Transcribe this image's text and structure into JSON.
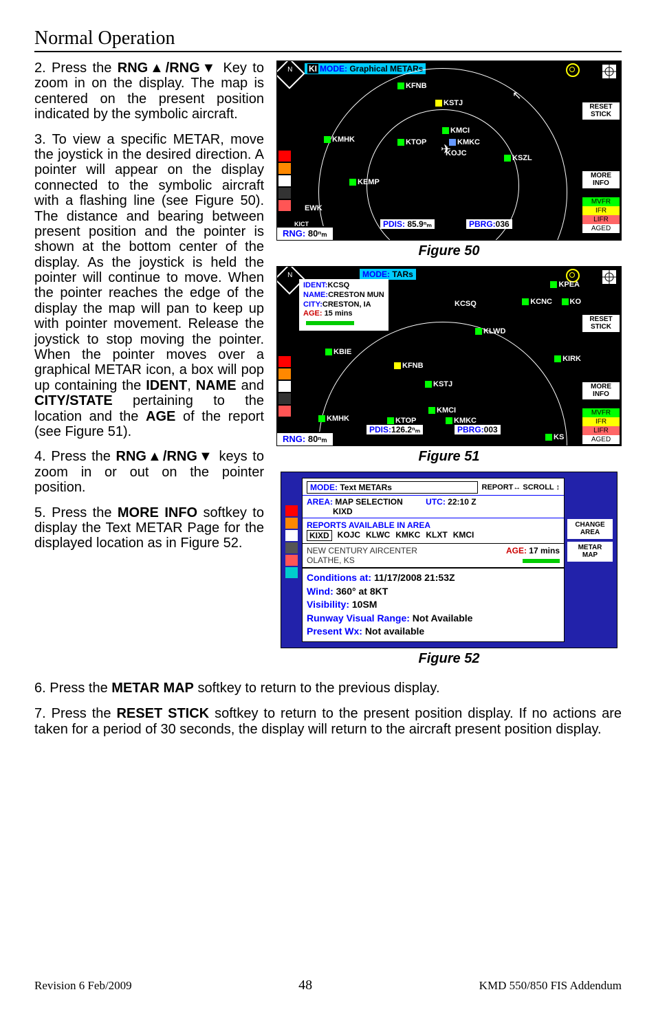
{
  "header": {
    "title": "Normal Operation"
  },
  "step2_a": "2. Press the ",
  "step2_key": "RNG▲/RNG▼",
  "step2_b": " Key to zoom in on the display. The map is centered on the present position indicated by the symbolic aircraft.",
  "step3": "3. To view a specific METAR, move the joystick in the desired direction. A pointer will appear on the display connected to the symbolic aircraft with a flashing line (see Figure 50). The distance and bearing between present position and the pointer is shown at the bottom center of the display. As the joystick is held the pointer will continue to move. When the pointer reaches the edge of the display the map will pan to keep up with pointer movement. Release the joystick to stop moving the pointer. When the pointer moves over a graphical METAR icon, a box will pop up containing the ",
  "step3_k1": "IDENT",
  "step3_c1": ", ",
  "step3_k2": "NAME",
  "step3_c2": " and ",
  "step3_k3": "CITY/STATE",
  "step3_d": " pertaining to the location and the ",
  "step3_k4": "AGE",
  "step3_e": " of the report (see Figure 51).",
  "step4_a": "4. Press the ",
  "step4_key": "RNG▲/RNG▼",
  "step4_b": " keys to zoom in or out on the pointer position.",
  "step5_a": "5. Press the ",
  "step5_key": "MORE INFO",
  "step5_b": " softkey to display the Text METAR Page for the displayed location as in Figure 52.",
  "fig50": {
    "caption": "Figure 50",
    "mode_label": "MODE:",
    "mode_value": "Graphical METARs",
    "rng_label": "RNG:",
    "rng_value": "80ⁿₘ",
    "pdis_label": "PDIS:",
    "pdis_value": "85.9ⁿₘ",
    "pbrg_label": "PBRG:",
    "pbrg_value": "036",
    "softkeys": {
      "reset": "RESET\nSTICK",
      "more": "MORE\nINFO"
    },
    "legend": {
      "mvfr": "MVFR",
      "ifr": "IFR",
      "lifr": "LIFR",
      "aged": "AGED"
    },
    "flags": {
      "kfnb": "KFNB",
      "kstj": "KSTJ",
      "kmci": "KMCI",
      "kmkc": "KMKC",
      "ktop": "KTOP",
      "kmhk": "KMHK",
      "kojc": "KOJC",
      "kszl": "KSZL",
      "kemp": "KEMP",
      "ewk": "EWK",
      "kict": "KICT"
    }
  },
  "fig51": {
    "caption": "Figure 51",
    "info": {
      "ident_l": "IDENT:",
      "ident_v": "KCSQ",
      "name_l": "NAME:",
      "name_v": "CRESTON MUN",
      "city_l": "CITY:",
      "city_v": "CRESTON, IA",
      "age_l": "AGE:",
      "age_v": "15 mins"
    },
    "rng_label": "RNG:",
    "rng_value": "80ⁿₘ",
    "pdis_label": "PDIS:",
    "pdis_value": "126.2ⁿₘ",
    "pbrg_label": "PBRG:",
    "pbrg_value": "003",
    "mode_tail": "TARs",
    "softkeys": {
      "reset": "RESET\nSTICK",
      "more": "MORE\nINFO"
    },
    "legend": {
      "mvfr": "MVFR",
      "ifr": "IFR",
      "lifr": "LIFR",
      "aged": "AGED"
    },
    "flags": {
      "kpea": "KPEA",
      "kcnc": "KCNC",
      "ko": "KO",
      "kcsq": "KCSQ",
      "klwd": "KLWD",
      "kbie": "KBIE",
      "kfnb": "KFNB",
      "kirk": "KIRK",
      "kstj": "KSTJ",
      "kmci": "KMCI",
      "kmkc": "KMKC",
      "ktop": "KTOP",
      "kmhk": "KMHK",
      "ks": "KS"
    }
  },
  "fig52": {
    "caption": "Figure 52",
    "mode_l": "MODE:",
    "mode_v": "Text METARs",
    "report_scroll": "REPORT↔  SCROLL ↕",
    "area_l": "AREA:",
    "area_v": "MAP SELECTION",
    "area_sub": "KIXD",
    "utc_l": "UTC:",
    "utc_v": "22:10 Z",
    "reports_head": "REPORTS AVAILABLE IN AREA",
    "stations": {
      "sel": "KIXD",
      "r1": "KOJC",
      "r2": "KLWC",
      "r3": "KMKC",
      "r4": "KLXT",
      "r5": "KMCI"
    },
    "station_name": "NEW CENTURY AIRCENTER",
    "station_city": "OLATHE, KS",
    "station_age_l": "AGE:",
    "station_age_v": "17 mins",
    "cond_l": "Conditions at:",
    "cond_v": "11/17/2008 21:53Z",
    "wind_l": "Wind:",
    "wind_v": "360° at 8KT",
    "vis_l": "Visibility:",
    "vis_v": "10SM",
    "rvr_l": "Runway Visual Range:",
    "rvr_v": "Not Available",
    "pwx_l": "Present Wx:",
    "pwx_v": "Not available",
    "softkeys": {
      "change": "CHANGE\nAREA",
      "map": "METAR\nMAP"
    }
  },
  "step6_a": "6. Press the ",
  "step6_key": "METAR MAP",
  "step6_b": " softkey to return to the previous display.",
  "step7_a": "7. Press the ",
  "step7_key": "RESET STICK",
  "step7_b": " softkey to return to the present position display. If no actions are taken for a period of 30 seconds, the display will return to the aircraft present position display.",
  "footer": {
    "rev": "Revision 6  Feb/2009",
    "page": "48",
    "doc": "KMD 550/850 FIS Addendum"
  }
}
